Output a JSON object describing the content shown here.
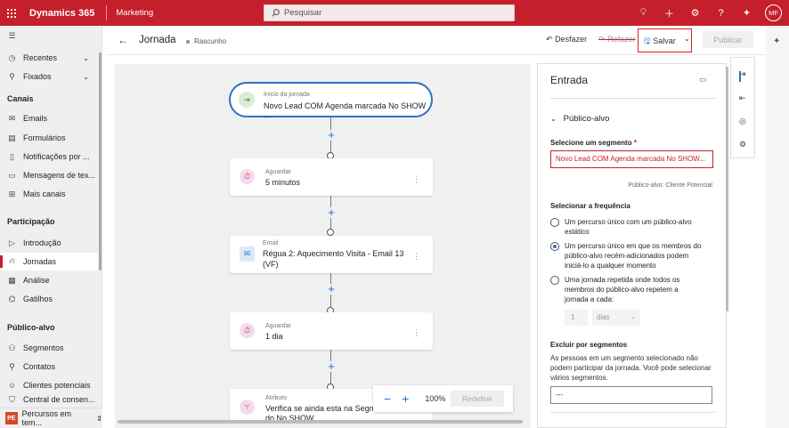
{
  "topbar": {
    "brand": "Dynamics 365",
    "app": "Marketing",
    "search_placeholder": "Pesquisar",
    "avatar": "MF",
    "accent": "#c51f2c"
  },
  "sidebar": {
    "recent": "Recentes",
    "pinned": "Fixados",
    "channels_title": "Canais",
    "channels": [
      "Emails",
      "Formulários",
      "Notificações por ...",
      "Mensagens de tex...",
      "Mais canais"
    ],
    "engagement_title": "Participação",
    "engagement": [
      "Introdução",
      "Jornadas",
      "Análise",
      "Gatilhos"
    ],
    "audience_title": "Público-alvo",
    "audience": [
      "Segmentos",
      "Contatos",
      "Clientes potenciais",
      "Central de consen..."
    ],
    "area_badge": "PE",
    "area_name": "Percursos em tem..."
  },
  "header": {
    "title": "Jornada",
    "status": "Rascunho",
    "undo": "Desfazer",
    "redo": "Refazer",
    "save": "Salvar",
    "publish": "Publicar"
  },
  "canvas": {
    "start": {
      "small": "Início da jornada",
      "main": "Novo Lead COM Agenda marcada No SHOW ..."
    },
    "wait1": {
      "small": "Aguardar",
      "main": "5 minutos"
    },
    "email": {
      "small": "Email",
      "main1": "Régua 2: Aquecimento Visita - Email 13",
      "main2": "(VF)"
    },
    "wait2": {
      "small": "Aguardar",
      "main": "1 dia"
    },
    "attr": {
      "small": "Atributo",
      "main1": "Verifica se ainda esta na Segme",
      "main2": "do No SHOW"
    },
    "zoom": "100%",
    "reset": "Redefinir"
  },
  "panel": {
    "title": "Entrada",
    "section": "Público-alvo",
    "segment_label": "Selecione um segmento",
    "required_mark": "*",
    "segment_value": "Novo Lead COM Agenda marcada No SHOW...",
    "audience_hint": "Público-alvo: Cliente Potencial",
    "frequency_label": "Selecionar a frequência",
    "options": [
      {
        "l1": "Um percurso único com um público-alvo",
        "l2": "estático",
        "l3": ""
      },
      {
        "l1": "Um percurso único em que os membros do",
        "l2": "público-alvo recém-adicionados podem",
        "l3": "iniciá-lo a qualquer momento"
      },
      {
        "l1": "Uma jornada repetida onde todos os",
        "l2": "membros do público-alvo repetem a",
        "l3": "jornada a cada:"
      }
    ],
    "selected_option": 1,
    "repeat_num": "1",
    "repeat_unit": "dias",
    "exclude_label": "Excluir por segmentos",
    "exclude_desc": "As pessoas em um segmento selecionado não podem participar da jornada. Você pode selecionar vários segmentos.",
    "exclude_value": "---"
  }
}
